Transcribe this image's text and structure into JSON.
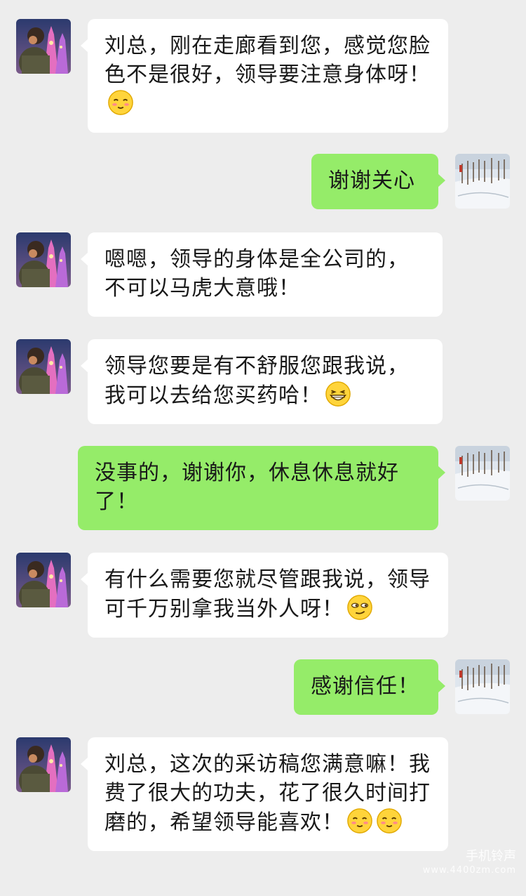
{
  "messages": [
    {
      "side": "in",
      "text": "刘总，刚在走廊看到您，感觉您脸色不是很好，领导要注意身体呀！",
      "emoji": [
        "blush-emoji"
      ]
    },
    {
      "side": "out",
      "text": "谢谢关心",
      "emoji": []
    },
    {
      "side": "in",
      "text": "嗯嗯，领导的身体是全公司的，不可以马虎大意哦！",
      "emoji": []
    },
    {
      "side": "in",
      "text": "领导您要是有不舒服您跟我说，我可以去给您买药哈！",
      "emoji": [
        "grin-emoji"
      ]
    },
    {
      "side": "out",
      "text": "没事的，谢谢你，休息休息就好了！",
      "emoji": []
    },
    {
      "side": "in",
      "text": "有什么需要您就尽管跟我说，领导可千万别拿我当外人呀！",
      "emoji": [
        "smirk-emoji"
      ]
    },
    {
      "side": "out",
      "text": "感谢信任！",
      "emoji": []
    },
    {
      "side": "in",
      "text": "刘总，这次的采访稿您满意嘛！我费了很大的功夫，花了很久时间打磨的，希望领导能喜欢！",
      "emoji": [
        "blush-emoji",
        "blush-emoji"
      ]
    }
  ],
  "watermark": {
    "line1": "手机铃声",
    "line2": "www.4400zm.com"
  },
  "colors": {
    "background": "#ededed",
    "incoming_bubble": "#ffffff",
    "outgoing_bubble": "#95ec69",
    "text": "#191919"
  }
}
